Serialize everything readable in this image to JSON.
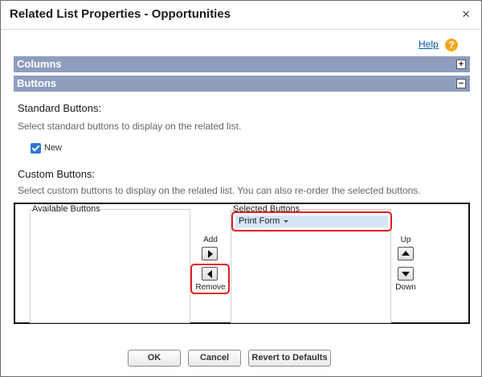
{
  "dialog": {
    "title": "Related List Properties - Opportunities",
    "close_glyph": "×",
    "help_label": "Help",
    "help_glyph": "?"
  },
  "sections": {
    "columns_label": "Columns",
    "columns_toggle": "+",
    "buttons_label": "Buttons",
    "buttons_toggle": "−"
  },
  "standard_buttons": {
    "heading": "Standard Buttons:",
    "description": "Select standard buttons to display on the related list.",
    "options": [
      {
        "label": "New",
        "checked": true
      }
    ]
  },
  "custom_buttons": {
    "heading": "Custom Buttons:",
    "description": "Select custom buttons to display on the related list. You can also re-order the selected buttons.",
    "available_label": "Available Buttons",
    "selected_label": "Selected Buttons",
    "selected_items": [
      "Print Form"
    ],
    "add_label": "Add",
    "remove_label": "Remove",
    "up_label": "Up",
    "down_label": "Down"
  },
  "footer": {
    "ok_label": "OK",
    "cancel_label": "Cancel",
    "reset_label": "Revert to Defaults"
  },
  "colors": {
    "section_bar": "#8e9dbe",
    "highlight": "#e01e1e",
    "link": "#015ba7",
    "help_icon": "#f4a81e",
    "selected_item_bg": "#d7e5f7"
  }
}
